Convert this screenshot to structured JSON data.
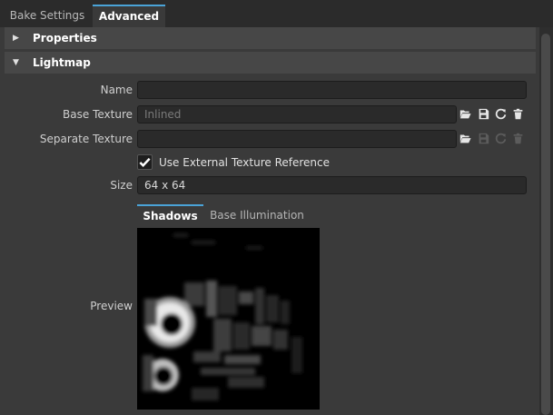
{
  "tabs": [
    {
      "label": "Bake Settings",
      "active": false
    },
    {
      "label": "Advanced",
      "active": true
    }
  ],
  "sections": {
    "properties": {
      "title": "Properties",
      "expanded": false
    },
    "lightmap": {
      "title": "Lightmap",
      "expanded": true
    }
  },
  "fields": {
    "name": {
      "label": "Name",
      "value": ""
    },
    "base_texture": {
      "label": "Base Texture",
      "placeholder": "Inlined"
    },
    "separate_texture": {
      "label": "Separate Texture",
      "value": ""
    },
    "use_external": {
      "label": "Use External Texture Reference",
      "checked": true
    },
    "size": {
      "label": "Size",
      "value": "64 x 64"
    },
    "preview": {
      "label": "Preview"
    }
  },
  "preview_tabs": [
    {
      "label": "Shadows",
      "active": true
    },
    {
      "label": "Base Illumination",
      "active": false
    }
  ],
  "icons": {
    "base_texture": [
      "folder-open-icon",
      "save-icon",
      "refresh-icon",
      "trash-icon"
    ],
    "separate_texture": [
      "folder-open-icon",
      "save-icon",
      "refresh-icon",
      "trash-icon"
    ]
  },
  "colors": {
    "accent": "#4aa3d8",
    "panel": "#3a3a3a",
    "section_header": "#474747",
    "field_bg": "#2a2a2a"
  }
}
